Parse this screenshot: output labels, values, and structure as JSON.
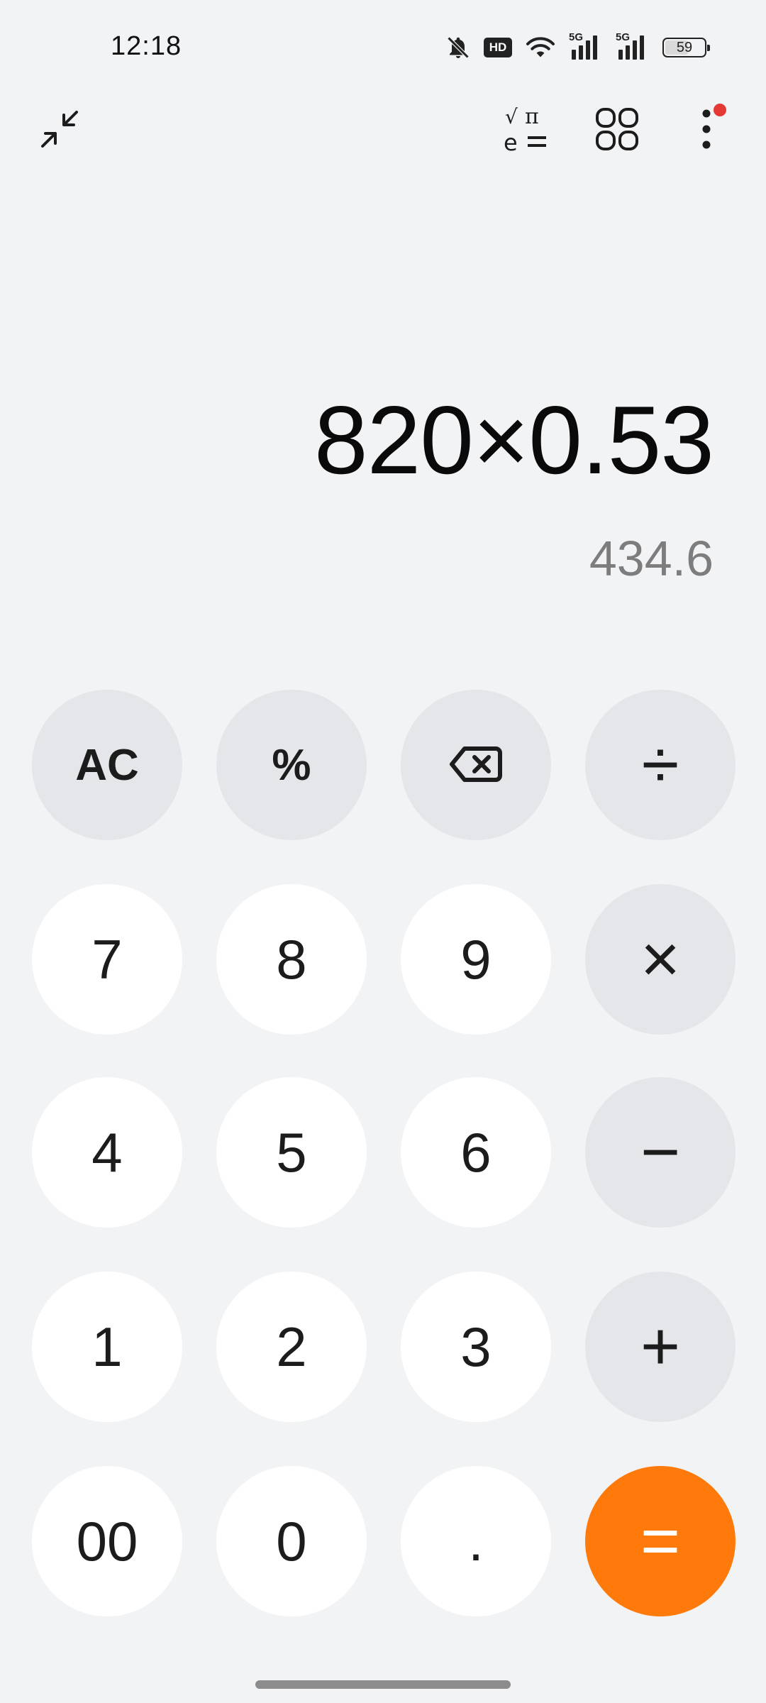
{
  "status_bar": {
    "time": "12:18",
    "battery": "59",
    "hd_label": "HD",
    "net1": "5G",
    "net2": "5G",
    "icons": [
      "bell-off-icon",
      "hd-voice-icon",
      "wifi-icon",
      "cellular-5g-icon",
      "cellular-5g-icon",
      "battery-icon"
    ]
  },
  "toolbar": {
    "collapse_icon": "collapse-arrows-icon",
    "scientific_icon": "scientific-functions-icon",
    "grid_icon": "converters-grid-icon",
    "more_icon": "more-vertical-icon",
    "notification_color": "#e53935"
  },
  "display": {
    "expression": "820×0.53",
    "result": "434.6"
  },
  "keys": {
    "clear": "AC",
    "percent": "%",
    "backspace_icon": "backspace-icon",
    "divide": "÷",
    "seven": "7",
    "eight": "8",
    "nine": "9",
    "multiply": "×",
    "four": "4",
    "five": "5",
    "six": "6",
    "minus": "−",
    "one": "1",
    "two": "2",
    "three": "3",
    "plus": "+",
    "double_zero": "00",
    "zero": "0",
    "decimal": ".",
    "equals": "="
  },
  "colors": {
    "background": "#f2f3f5",
    "digit_key": "#ffffff",
    "function_key": "#e5e6e9",
    "equals_key": "#ff7a0a"
  }
}
